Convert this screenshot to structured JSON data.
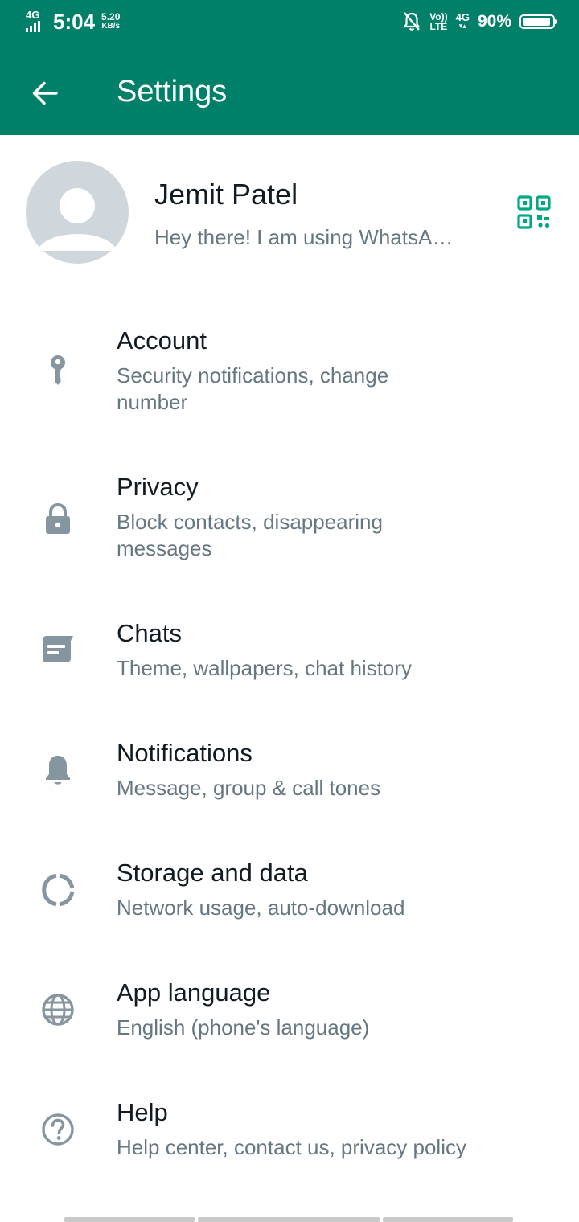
{
  "status_bar": {
    "network": "4G",
    "time": "5:04",
    "speed_value": "5.20",
    "speed_unit": "KB/s",
    "volte_top": "Vo))",
    "volte_bottom": "LTE",
    "net_right": "4G",
    "battery_percent": "90%",
    "battery_level": 0.9
  },
  "app_bar": {
    "title": "Settings",
    "back_icon": "arrow-back-icon"
  },
  "profile": {
    "name": "Jemit Patel",
    "about": "Hey there! I am using WhatsA…",
    "avatar_icon": "default-avatar-icon",
    "qr_icon": "qr-code-icon"
  },
  "settings": [
    {
      "key": "account",
      "title": "Account",
      "subtitle": "Security notifications, change number",
      "icon": "key-icon"
    },
    {
      "key": "privacy",
      "title": "Privacy",
      "subtitle": "Block contacts, disappearing messages",
      "icon": "lock-icon"
    },
    {
      "key": "chats",
      "title": "Chats",
      "subtitle": "Theme, wallpapers, chat history",
      "icon": "chat-icon"
    },
    {
      "key": "notifications",
      "title": "Notifications",
      "subtitle": "Message, group & call tones",
      "icon": "bell-icon"
    },
    {
      "key": "storage",
      "title": "Storage and data",
      "subtitle": "Network usage, auto-download",
      "icon": "storage-circle-icon"
    },
    {
      "key": "language",
      "title": "App language",
      "subtitle": "English (phone's language)",
      "icon": "globe-icon"
    },
    {
      "key": "help",
      "title": "Help",
      "subtitle": "Help center, contact us, privacy policy",
      "icon": "help-icon"
    }
  ],
  "colors": {
    "primary": "#008069",
    "accent": "#00a884",
    "icon_gray": "#8696a0",
    "text_primary": "#111b21",
    "text_secondary": "#667781"
  }
}
